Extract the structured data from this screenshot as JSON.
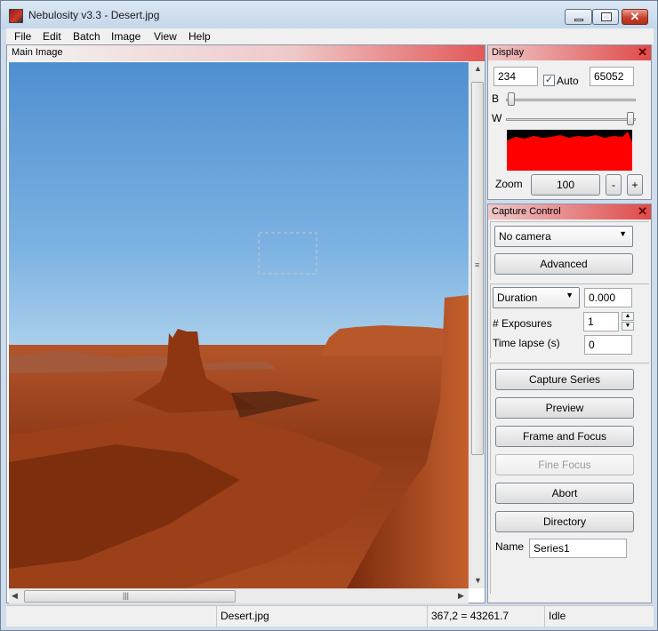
{
  "window": {
    "title": "Nebulosity v3.3 - Desert.jpg",
    "app_icon": "nebulosity-app-icon",
    "close_glyph": "✕"
  },
  "menu": [
    "File",
    "Edit",
    "Batch",
    "Image",
    "View",
    "Help"
  ],
  "main_pane": {
    "title": "Main Image",
    "image_description_icon": "desert-photo"
  },
  "display": {
    "title": "Display",
    "black_point": "234",
    "auto_label": "Auto",
    "auto_checked": true,
    "white_point": "65052",
    "b_label": "B",
    "w_label": "W",
    "b_slider_fraction": 0.0,
    "w_slider_fraction": 0.98,
    "zoom_label": "Zoom",
    "zoom_value": "100",
    "zoom_minus": "-",
    "zoom_plus": "+",
    "histogram_color": "#ff0000"
  },
  "capture": {
    "title": "Capture Control",
    "camera_select": "No camera",
    "advanced_button": "Advanced",
    "duration_select": "Duration",
    "duration_value": "0.000",
    "exposures_label": "# Exposures",
    "exposures_value": "1",
    "time_lapse_label": "Time lapse (s)",
    "time_lapse_value": "0",
    "buttons": {
      "capture_series": "Capture Series",
      "preview": "Preview",
      "frame_and_focus": "Frame and Focus",
      "fine_focus": "Fine Focus",
      "abort": "Abort",
      "directory": "Directory"
    },
    "name_label": "Name",
    "name_value": "Series1"
  },
  "status": {
    "left": "",
    "file": "Desert.jpg",
    "pixel": "367,2 = 43261.7",
    "state": "Idle"
  },
  "colors": {
    "header_accent": "#e04a4a",
    "chrome": "#cfdceb"
  }
}
